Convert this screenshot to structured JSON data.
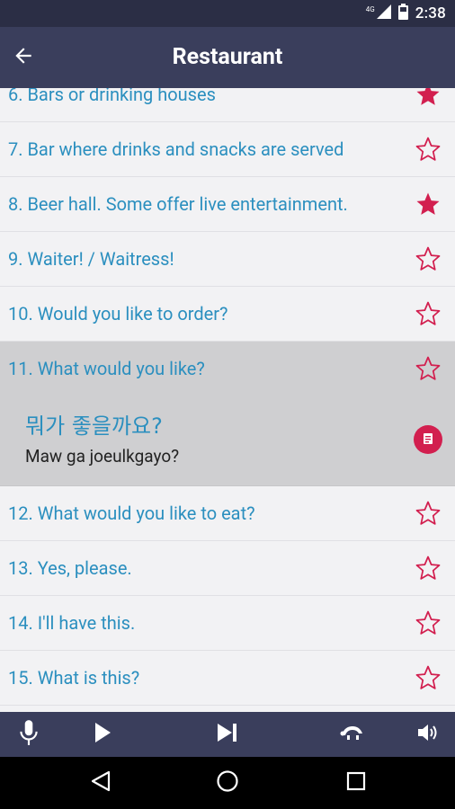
{
  "status_bar": {
    "network": "4G",
    "time": "2:38"
  },
  "header": {
    "title": "Restaurant"
  },
  "phrases": [
    {
      "label": "6. Bars or drinking houses",
      "starred": true
    },
    {
      "label": "7. Bar where drinks and snacks are served",
      "starred": false
    },
    {
      "label": "8. Beer hall. Some offer live entertainment.",
      "starred": true
    },
    {
      "label": "9. Waiter! / Waitress!",
      "starred": false
    },
    {
      "label": "10. Would you like to order?",
      "starred": false
    },
    {
      "label": "11. What would you like?",
      "starred": false,
      "translation": "뭐가 좋을까요?",
      "romanization": "Maw ga joeulkgayo?"
    },
    {
      "label": "12. What would you like to eat?",
      "starred": false
    },
    {
      "label": "13. Yes, please.",
      "starred": false
    },
    {
      "label": "14. I'll have this.",
      "starred": false
    },
    {
      "label": "15. What is this?",
      "starred": false
    }
  ],
  "colors": {
    "accent": "#d21f4f",
    "phrase_text": "#2b8fbf",
    "header_bg": "#3a3e5c",
    "status_bg": "#2b2e45",
    "expanded_bg": "#cfcfd1"
  },
  "icons": {
    "back": "arrow-left-icon",
    "star_filled": "star-filled-icon",
    "star_outline": "star-outline-icon",
    "mic": "microphone-icon",
    "play": "play-icon",
    "skip": "skip-next-icon",
    "slow": "turtle-icon",
    "volume": "volume-icon"
  }
}
